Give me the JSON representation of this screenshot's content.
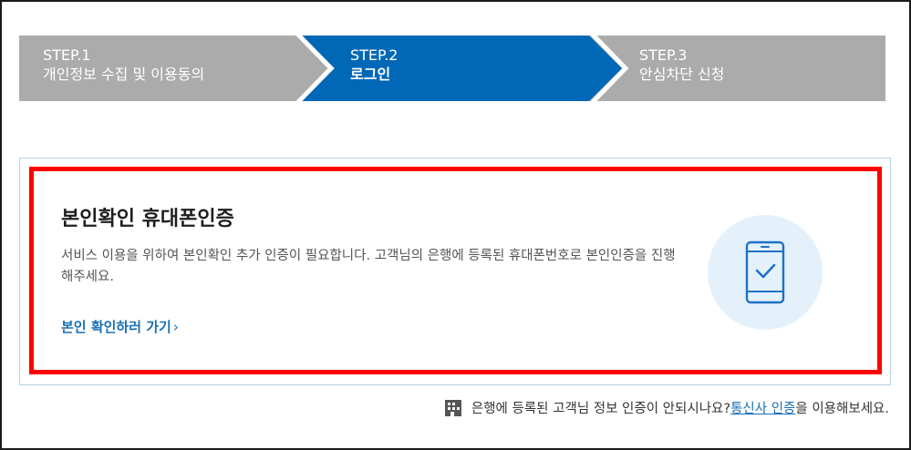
{
  "steps": [
    {
      "num": "STEP.1",
      "title": "개인정보 수집 및 이용동의",
      "active": false
    },
    {
      "num": "STEP.2",
      "title": "로그인",
      "active": true
    },
    {
      "num": "STEP.3",
      "title": "안심차단 신청",
      "active": false
    }
  ],
  "colors": {
    "step_inactive": "#ababab",
    "step_active": "#0068b6",
    "highlight": "#ff0000",
    "link": "#1a6fb4"
  },
  "auth": {
    "title": "본인확인 휴대폰인증",
    "description": "서비스 이용을 위하여 본인확인 추가 인증이 필요합니다. 고객님의 은행에 등록된 휴대폰번호로 본인인증을 진행해주세요.",
    "link_label": "본인 확인하러 가기",
    "link_chevron": "›",
    "illustration_icon": "phone-check-icon"
  },
  "footer": {
    "icon": "building-icon",
    "text_before": "은행에 등록된 고객님 정보 인증이 안되시나요? ",
    "link_label": "통신사 인증",
    "text_after": "을 이용해보세요."
  }
}
